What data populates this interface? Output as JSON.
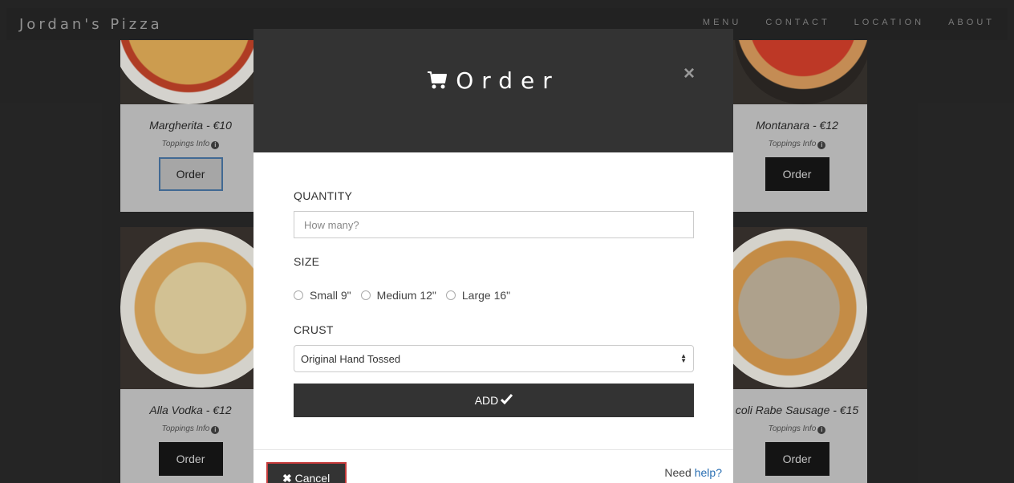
{
  "navbar": {
    "brand": "Jordan's Pizza",
    "links": [
      "MENU",
      "CONTACT",
      "LOCATION",
      "ABOUT"
    ]
  },
  "cards": [
    {
      "name": "Margherita - €10",
      "info": "Toppings Info",
      "button": "Order"
    },
    {
      "name": "Montanara - €12",
      "info": "Toppings Info",
      "button": "Order"
    },
    {
      "name": "Alla Vodka - €12",
      "info": "Toppings Info",
      "button": "Order"
    },
    {
      "name": "coli Rabe Sausage - €15",
      "info": "Toppings Info",
      "button": "Order"
    }
  ],
  "modal": {
    "title": "Order",
    "close": "×",
    "quantity_label": "QUANTITY",
    "quantity_placeholder": "How many?",
    "size_label": "SIZE",
    "sizes": [
      "Small 9\"",
      "Medium 12\"",
      "Large 16\""
    ],
    "crust_label": "CRUST",
    "crust_value": "Original Hand Tossed",
    "add_label": "ADD",
    "cancel_label": "Cancel",
    "help_prefix": "Need",
    "help_link": "help?"
  },
  "colors": {
    "modal_header": "#333333",
    "link": "#2a6fb3",
    "cancel_border": "#c53a3a"
  }
}
